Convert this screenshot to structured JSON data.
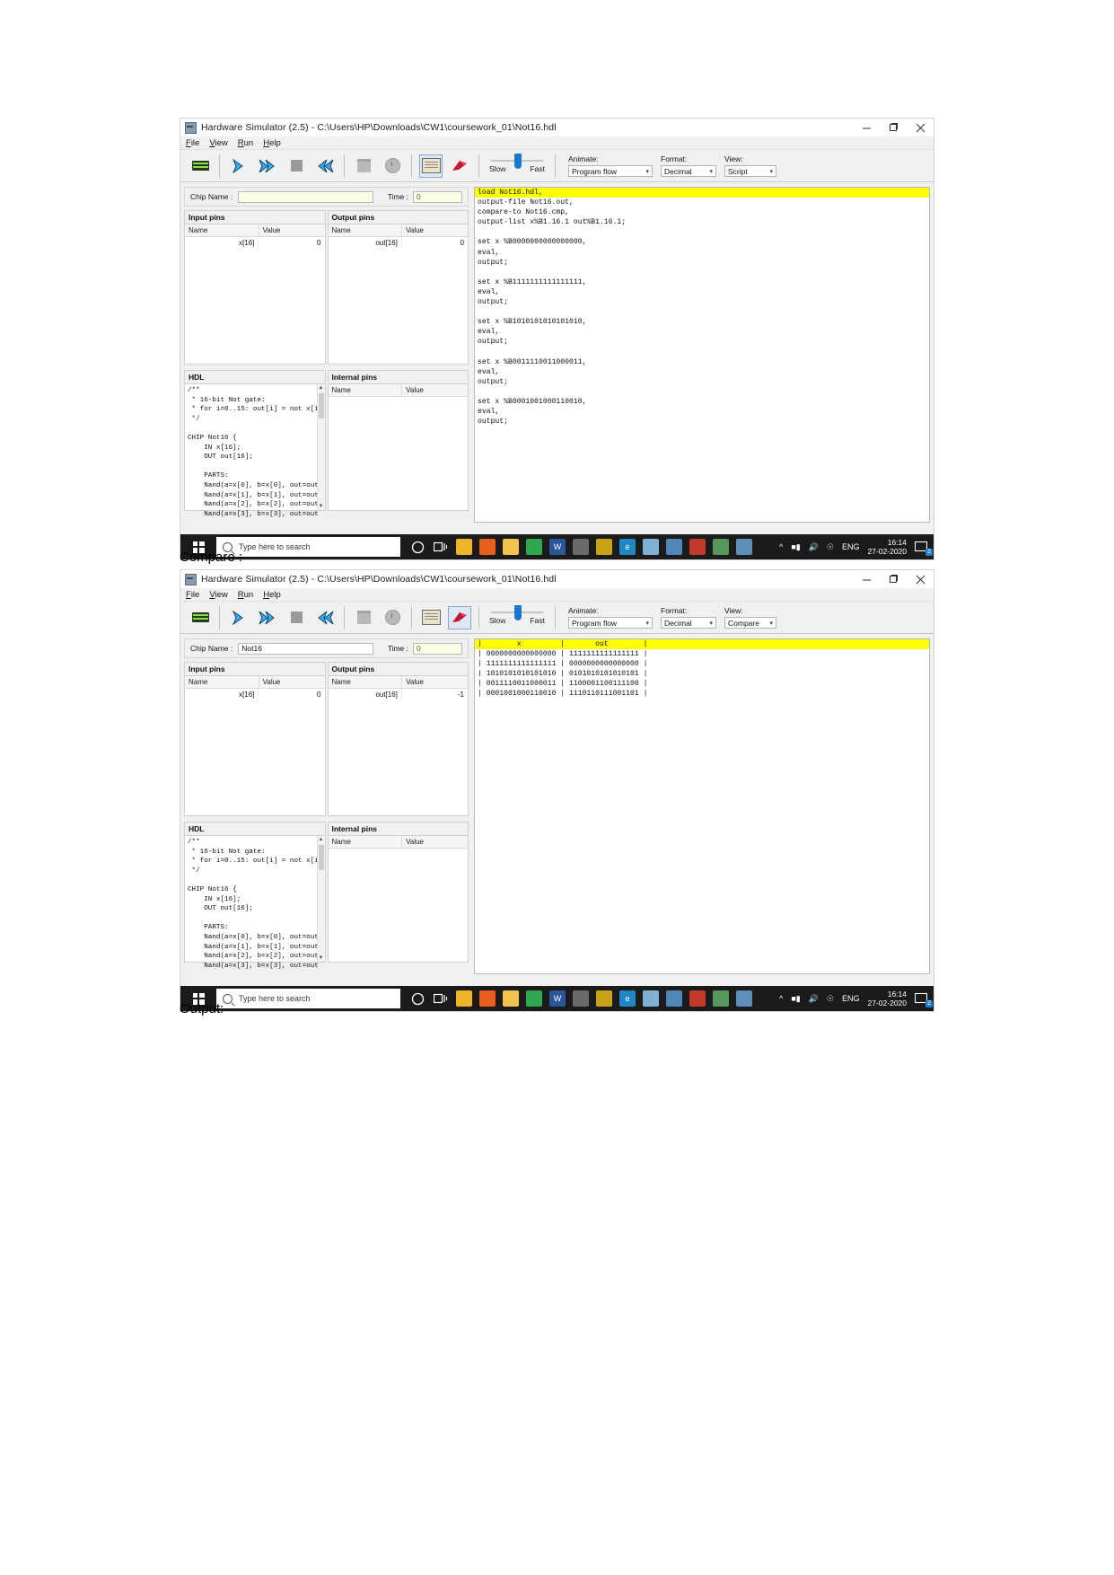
{
  "document": {
    "label_compare": "Compare :",
    "label_output": "Output:"
  },
  "window": {
    "title": "Hardware Simulator (2.5) - C:\\Users\\HP\\Downloads\\CW1\\coursework_01\\Not16.hdl",
    "icon": "app-icon",
    "buttons": {
      "minimize": "minimize",
      "maximize": "restore",
      "close": "close"
    },
    "menu": [
      "File",
      "View",
      "Run",
      "Help"
    ]
  },
  "toolbar": {
    "icons": [
      "chip-icon",
      "single-step-icon",
      "fast-forward-icon",
      "stop-icon",
      "rewind-icon",
      "program-icon",
      "clock-icon",
      "script-icon",
      "flag-icon"
    ],
    "speed": {
      "slow_label": "Slow",
      "fast_label": "Fast"
    },
    "animate": {
      "label": "Animate:",
      "value": "Program flow"
    },
    "format": {
      "label": "Format:",
      "value": "Decimal"
    },
    "view": {
      "label": "View:",
      "value_script": "Script",
      "value_compare": "Compare"
    }
  },
  "chiprow": {
    "chip_label": "Chip Name :",
    "chip_value_empty": "",
    "chip_value_filled": "Not16",
    "time_label": "Time :",
    "time_value": "0"
  },
  "pins": {
    "input_title": "Input pins",
    "output_title": "Output pins",
    "internal_title": "Internal pins",
    "hdl_title": "HDL",
    "col_name": "Name",
    "col_value": "Value",
    "input_rows": [
      {
        "name": "x[16]",
        "value": "0"
      }
    ],
    "output_rows_top": [
      {
        "name": "out[16]",
        "value": "0"
      }
    ],
    "output_rows_bottom": [
      {
        "name": "out[16]",
        "value": "-1"
      }
    ],
    "internal_rows": []
  },
  "hdl_code": "/**\n * 16-bit Not gate:\n * for i=0..15: out[i] = not x[i\n */\n\nCHIP Not16 {\n    IN x[16];\n    OUT out[16];\n\n    PARTS:\n    Nand(a=x[0], b=x[0], out=out\n    Nand(a=x[1], b=x[1], out=out\n    Nand(a=x[2], b=x[2], out=out\n    Nand(a=x[3], b=x[3], out=out",
  "script": {
    "highlight_line": "load Not16.hdl,",
    "lines": [
      "output-file Not16.out,",
      "compare-to Not16.cmp,",
      "output-list x%B1.16.1 out%B1.16.1;",
      "",
      "set x %B0000000000000000,",
      "eval,",
      "output;",
      "",
      "set x %B1111111111111111,",
      "eval,",
      "output;",
      "",
      "set x %B1010101010101010,",
      "eval,",
      "output;",
      "",
      "set x %B0011110011000011,",
      "eval,",
      "output;",
      "",
      "set x %B0001001000110010,",
      "eval,",
      "output;"
    ]
  },
  "compare": {
    "header": "|        x         |       out        |",
    "rows": [
      "| 0000000000000000 | 1111111111111111 |",
      "| 1111111111111111 | 0000000000000000 |",
      "| 1010101010101010 | 0101010101010101 |",
      "| 0011110011000011 | 1100001100111100 |",
      "| 0001001000110010 | 1110110111001101 |"
    ]
  },
  "taskbar": {
    "start": "windows-logo",
    "search_placeholder": "Type here to search",
    "cortana": "cortana-icon",
    "taskview": "task-view-icon",
    "apps": [
      "chrome-icon",
      "firefox-icon",
      "file-explorer-icon",
      "browser-icon",
      "word-icon",
      "vscode-icon",
      "sublime-icon",
      "edge-icon",
      "photos-icon",
      "java-icon",
      "office-icon",
      "paint-icon",
      "settings-icon"
    ],
    "tray": {
      "chevron": "show-hidden-icon",
      "battery": "battery-icon",
      "volume": "volume-icon",
      "network": "network-icon",
      "language": "ENG"
    },
    "clock": {
      "time": "16:14",
      "date": "27-02-2020"
    },
    "notifications": {
      "icon": "notification-icon",
      "count": "2"
    }
  }
}
